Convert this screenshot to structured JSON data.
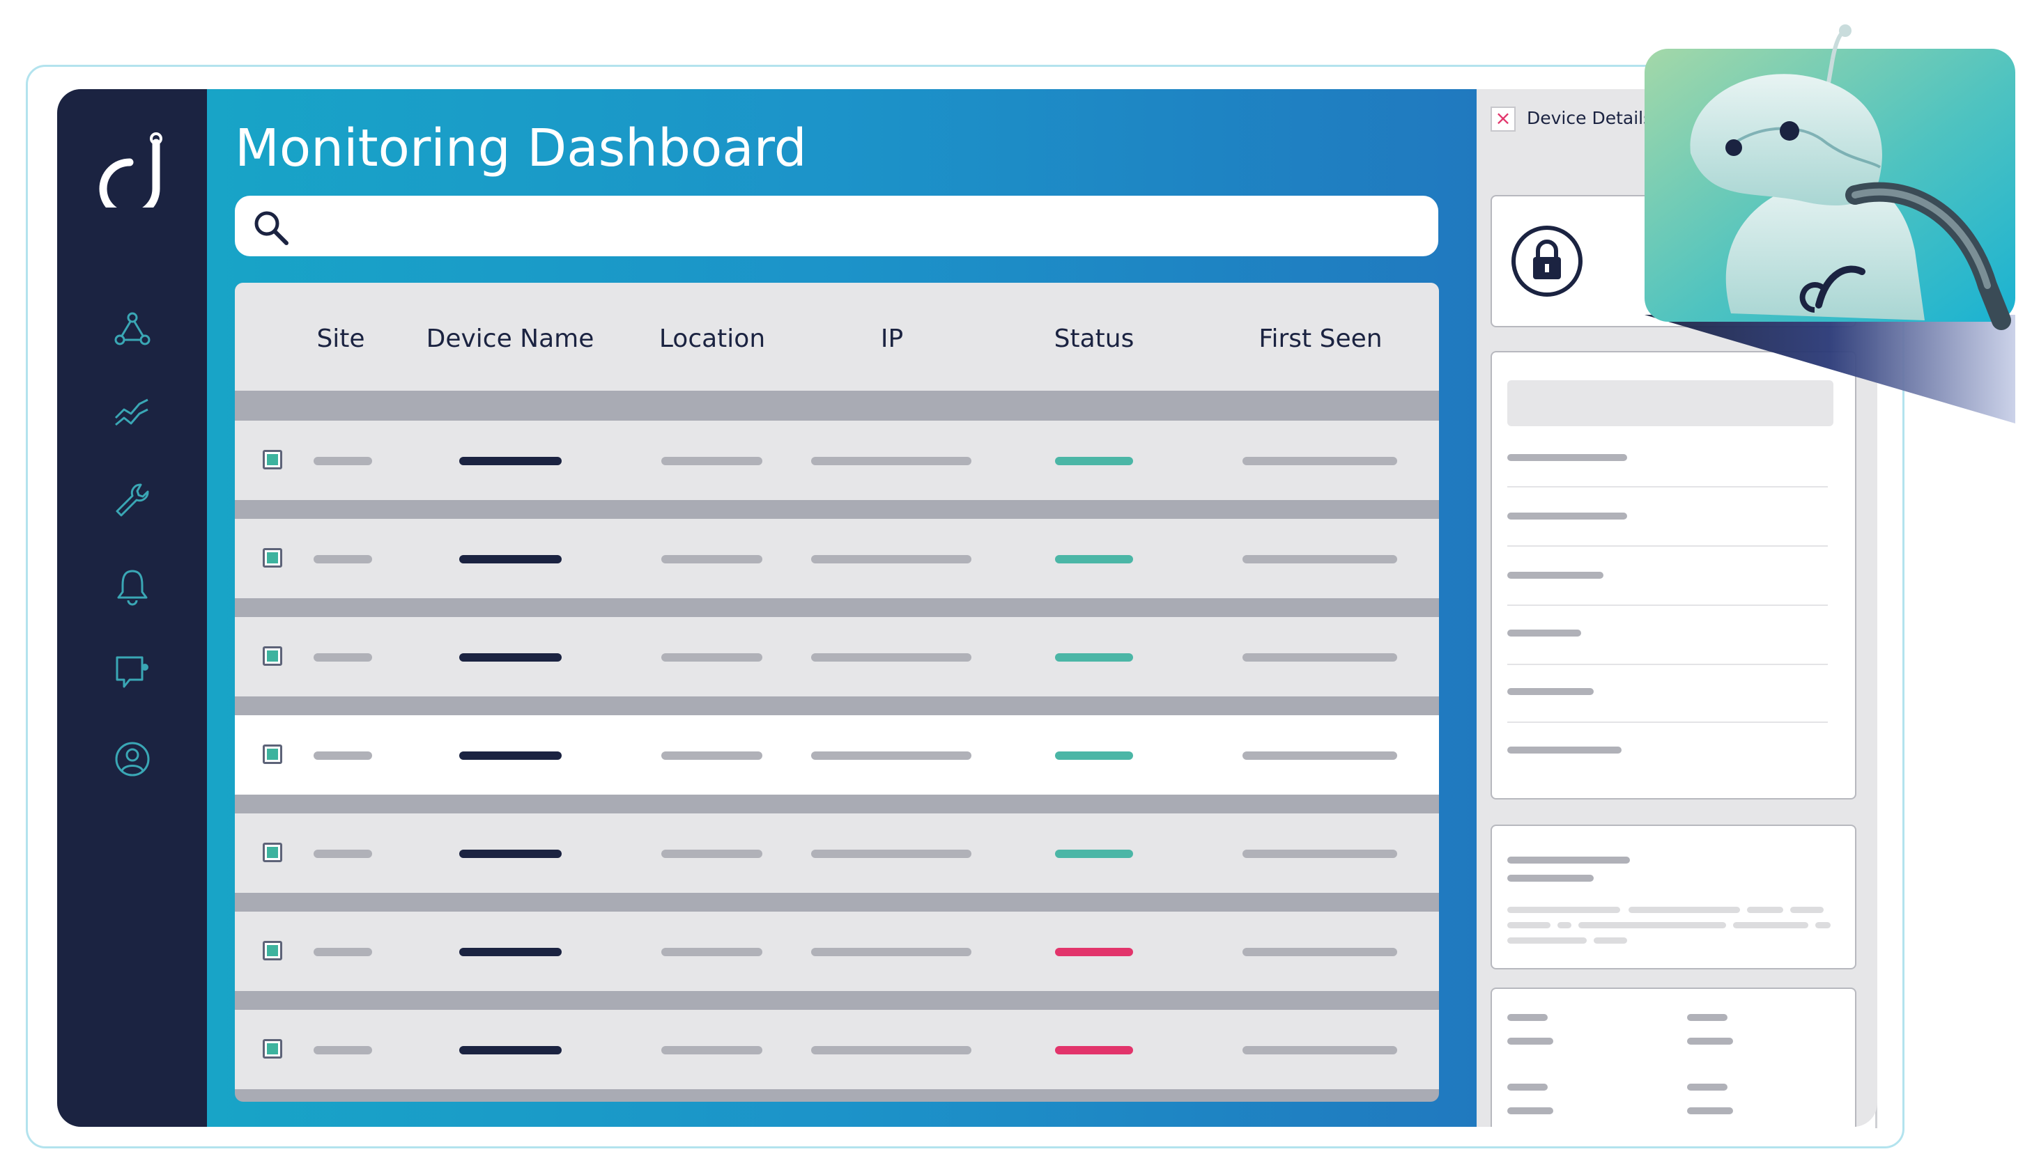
{
  "page": {
    "title": "Monitoring Dashboard"
  },
  "sidebar": {
    "logo": "d-logo-icon",
    "items": [
      {
        "icon": "network-icon"
      },
      {
        "icon": "trend-chart-icon"
      },
      {
        "icon": "wrench-icon"
      },
      {
        "icon": "bell-icon"
      },
      {
        "icon": "message-icon"
      },
      {
        "icon": "user-icon"
      }
    ]
  },
  "search": {
    "placeholder": "",
    "value": ""
  },
  "table": {
    "columns": [
      "Site",
      "Device Name",
      "Location",
      "IP",
      "Status",
      "First Seen"
    ],
    "rows": [
      {
        "checked": true,
        "status": "ok"
      },
      {
        "checked": true,
        "status": "ok"
      },
      {
        "checked": true,
        "status": "ok"
      },
      {
        "checked": true,
        "status": "ok",
        "highlighted": true
      },
      {
        "checked": true,
        "status": "ok"
      },
      {
        "checked": true,
        "status": "alert"
      },
      {
        "checked": true,
        "status": "alert"
      }
    ]
  },
  "device_details": {
    "title": "Device Details",
    "close_icon": "close-icon",
    "lock_icon": "lock-icon"
  },
  "colors": {
    "sidebar": "#1b2341",
    "accent_teal": "#3db39e",
    "status_ok": "#4bb6a6",
    "status_alert": "#e2346b",
    "dark_bar": "#1b2341",
    "gray_bar": "#b0b1b8"
  },
  "mascot": {
    "icon": "robot-mascot-icon"
  }
}
